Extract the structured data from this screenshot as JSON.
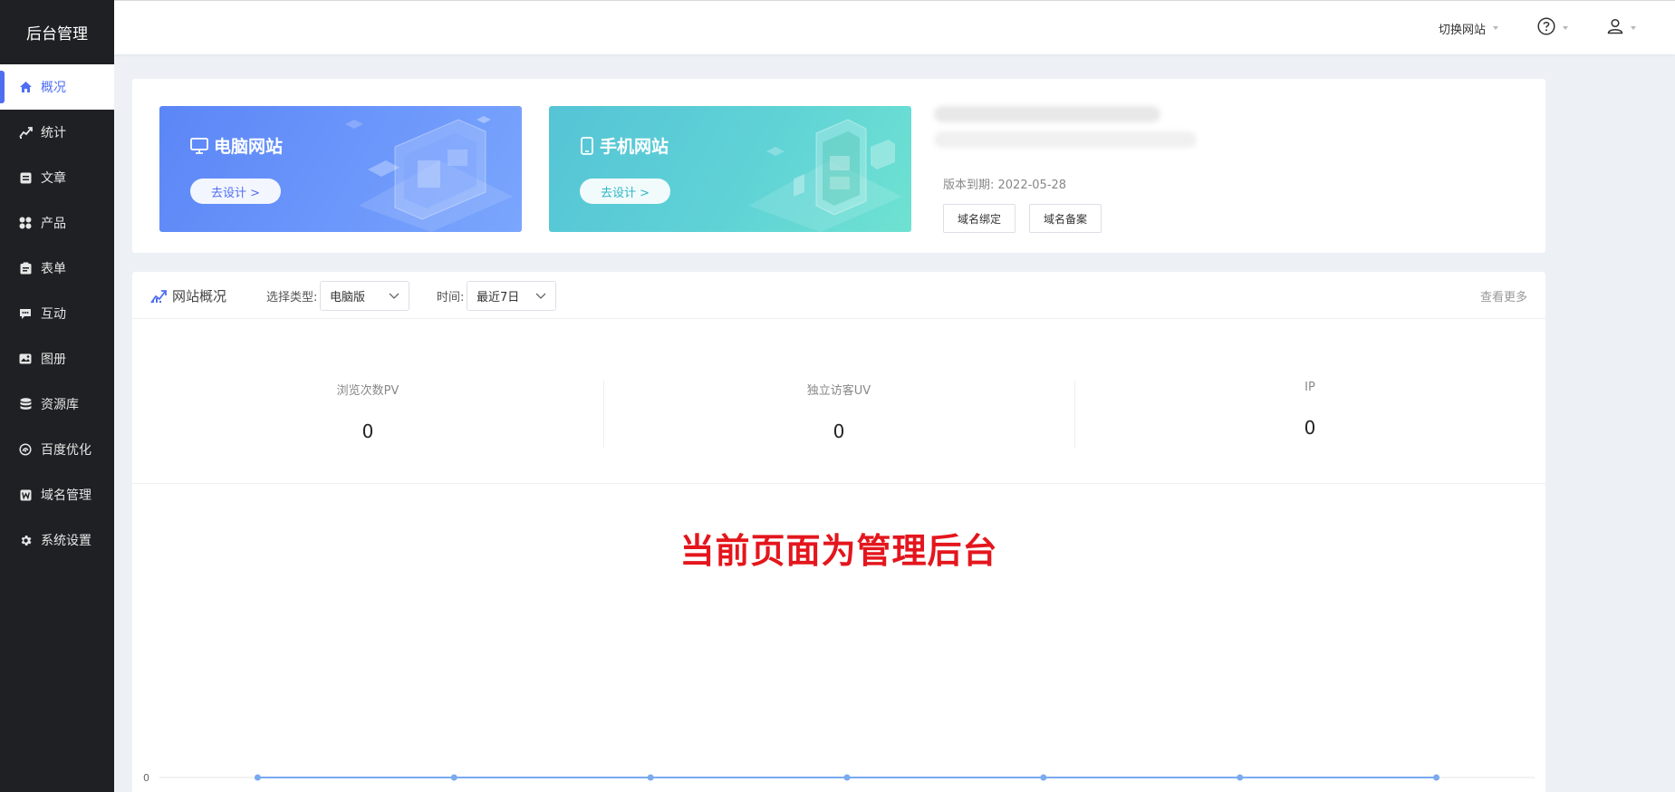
{
  "sidebar": {
    "brand": "后台管理",
    "items": [
      {
        "label": "概况",
        "icon": "home-icon"
      },
      {
        "label": "统计",
        "icon": "trend-icon"
      },
      {
        "label": "文章",
        "icon": "article-icon"
      },
      {
        "label": "产品",
        "icon": "grid-icon"
      },
      {
        "label": "表单",
        "icon": "clipboard-icon"
      },
      {
        "label": "互动",
        "icon": "chat-icon"
      },
      {
        "label": "图册",
        "icon": "album-icon"
      },
      {
        "label": "资源库",
        "icon": "database-icon"
      },
      {
        "label": "百度优化",
        "icon": "seo-icon"
      },
      {
        "label": "域名管理",
        "icon": "domain-icon"
      },
      {
        "label": "系统设置",
        "icon": "gear-icon"
      }
    ]
  },
  "header": {
    "switch_site": "切换网站"
  },
  "banners": {
    "pc": {
      "title": "电脑网站",
      "button": "去设计 >"
    },
    "mobile": {
      "title": "手机网站",
      "button": "去设计 >"
    }
  },
  "site_info": {
    "expire": "版本到期: 2022-05-28",
    "bind_domain": "域名绑定",
    "record_domain": "域名备案"
  },
  "overview": {
    "title": "网站概况",
    "type_label": "选择类型:",
    "type_value": "电脑版",
    "time_label": "时间:",
    "time_value": "最近7日",
    "more": "查看更多",
    "stats": [
      {
        "label": "浏览次数PV",
        "value": "0"
      },
      {
        "label": "独立访客UV",
        "value": "0"
      },
      {
        "label": "IP",
        "value": "0"
      }
    ],
    "watermark": "当前页面为管理后台"
  },
  "colors": {
    "sidebar_bg": "#1f2023",
    "accent": "#4e6ef2",
    "watermark": "#e4161d",
    "line": "#7aaaf0"
  },
  "chart_data": {
    "type": "line",
    "y_tick_labels": [
      "0"
    ],
    "ylim": [
      0,
      1
    ],
    "series": [
      {
        "values": [
          0,
          0,
          0,
          0,
          0,
          0,
          0
        ]
      }
    ],
    "grid": true
  }
}
